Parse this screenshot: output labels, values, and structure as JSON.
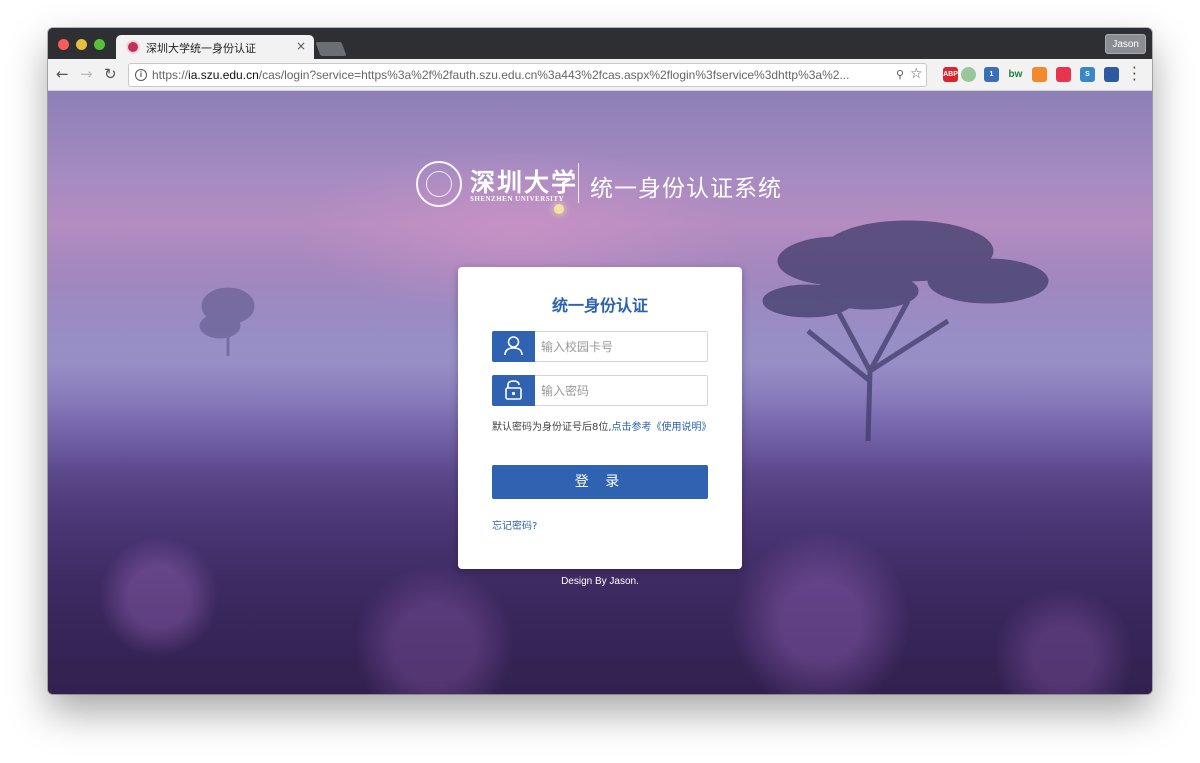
{
  "browser": {
    "tab_title": "深圳大学统一身份认证",
    "tab_close": "×",
    "profile_name": "Jason",
    "url_scheme": "https://",
    "url_host": "ia.szu.edu.cn",
    "url_path": "/cas/login?service=https%3a%2f%2fauth.szu.edu.cn%3a443%2fcas.aspx%2flogin%3fservice%3dhttp%3a%2...",
    "extensions": [
      {
        "name": "abp-icon",
        "label": "ABP",
        "color": "#d9252b"
      },
      {
        "name": "green-dot-icon",
        "label": "",
        "color": "#9ac79a"
      },
      {
        "name": "badge-extension-icon",
        "label": "1",
        "color": "#3a6fb8"
      },
      {
        "name": "bw-icon",
        "label": "bw",
        "color": "#1f7f3b"
      },
      {
        "name": "orange-extension-icon",
        "label": "",
        "color": "#f28a2b"
      },
      {
        "name": "checkmark-extension-icon",
        "label": "",
        "color": "#e8344e"
      },
      {
        "name": "s-extension-icon",
        "label": "S",
        "color": "#3b86c8"
      },
      {
        "name": "arrow-extension-icon",
        "label": "",
        "color": "#2c5aa0"
      }
    ]
  },
  "header": {
    "university_cn": "深圳大学",
    "university_en": "SHENZHEN UNIVERSITY",
    "system_name": "统一身份认证系统"
  },
  "login": {
    "title": "统一身份认证",
    "username_placeholder": "输入校园卡号",
    "password_placeholder": "输入密码",
    "hint_text": "默认密码为身份证号后8位,",
    "hint_link": "点击参考《使用说明》",
    "submit_label": "登 录",
    "forgot_label": "忘记密码?"
  },
  "footer": {
    "credit": "Design By Jason."
  },
  "colors": {
    "primary": "#2f63b1",
    "title": "#2d62b0"
  }
}
